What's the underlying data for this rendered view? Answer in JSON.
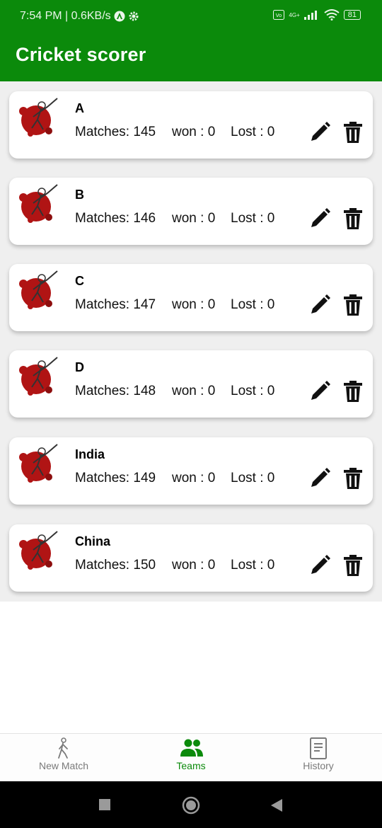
{
  "status_bar": {
    "time_speed": "7:54 PM | 0.6KB/s",
    "network": "4G+",
    "battery": "81"
  },
  "app_bar": {
    "title": "Cricket scorer"
  },
  "teams": [
    {
      "name": "A",
      "matches_label": "Matches:",
      "matches": "145",
      "won_label": "won :",
      "won": "0",
      "lost_label": "Lost :",
      "lost": "0"
    },
    {
      "name": "B",
      "matches_label": "Matches:",
      "matches": "146",
      "won_label": "won :",
      "won": "0",
      "lost_label": "Lost :",
      "lost": "0"
    },
    {
      "name": "C",
      "matches_label": "Matches:",
      "matches": "147",
      "won_label": "won :",
      "won": "0",
      "lost_label": "Lost :",
      "lost": "0"
    },
    {
      "name": "D",
      "matches_label": "Matches:",
      "matches": "148",
      "won_label": "won :",
      "won": "0",
      "lost_label": "Lost :",
      "lost": "0"
    },
    {
      "name": "India",
      "matches_label": "Matches:",
      "matches": "149",
      "won_label": "won :",
      "won": "0",
      "lost_label": "Lost :",
      "lost": "0"
    },
    {
      "name": "China",
      "matches_label": "Matches:",
      "matches": "150",
      "won_label": "won :",
      "won": "0",
      "lost_label": "Lost :",
      "lost": "0"
    }
  ],
  "bottom_nav": {
    "items": [
      {
        "label": "New Match",
        "icon": "walking-person-icon",
        "active": false
      },
      {
        "label": "Teams",
        "icon": "people-icon",
        "active": true
      },
      {
        "label": "History",
        "icon": "history-document-icon",
        "active": false
      }
    ]
  },
  "colors": {
    "primary": "#0b8a0b",
    "logo_red": "#b01414",
    "inactive": "#7a7a7a"
  }
}
